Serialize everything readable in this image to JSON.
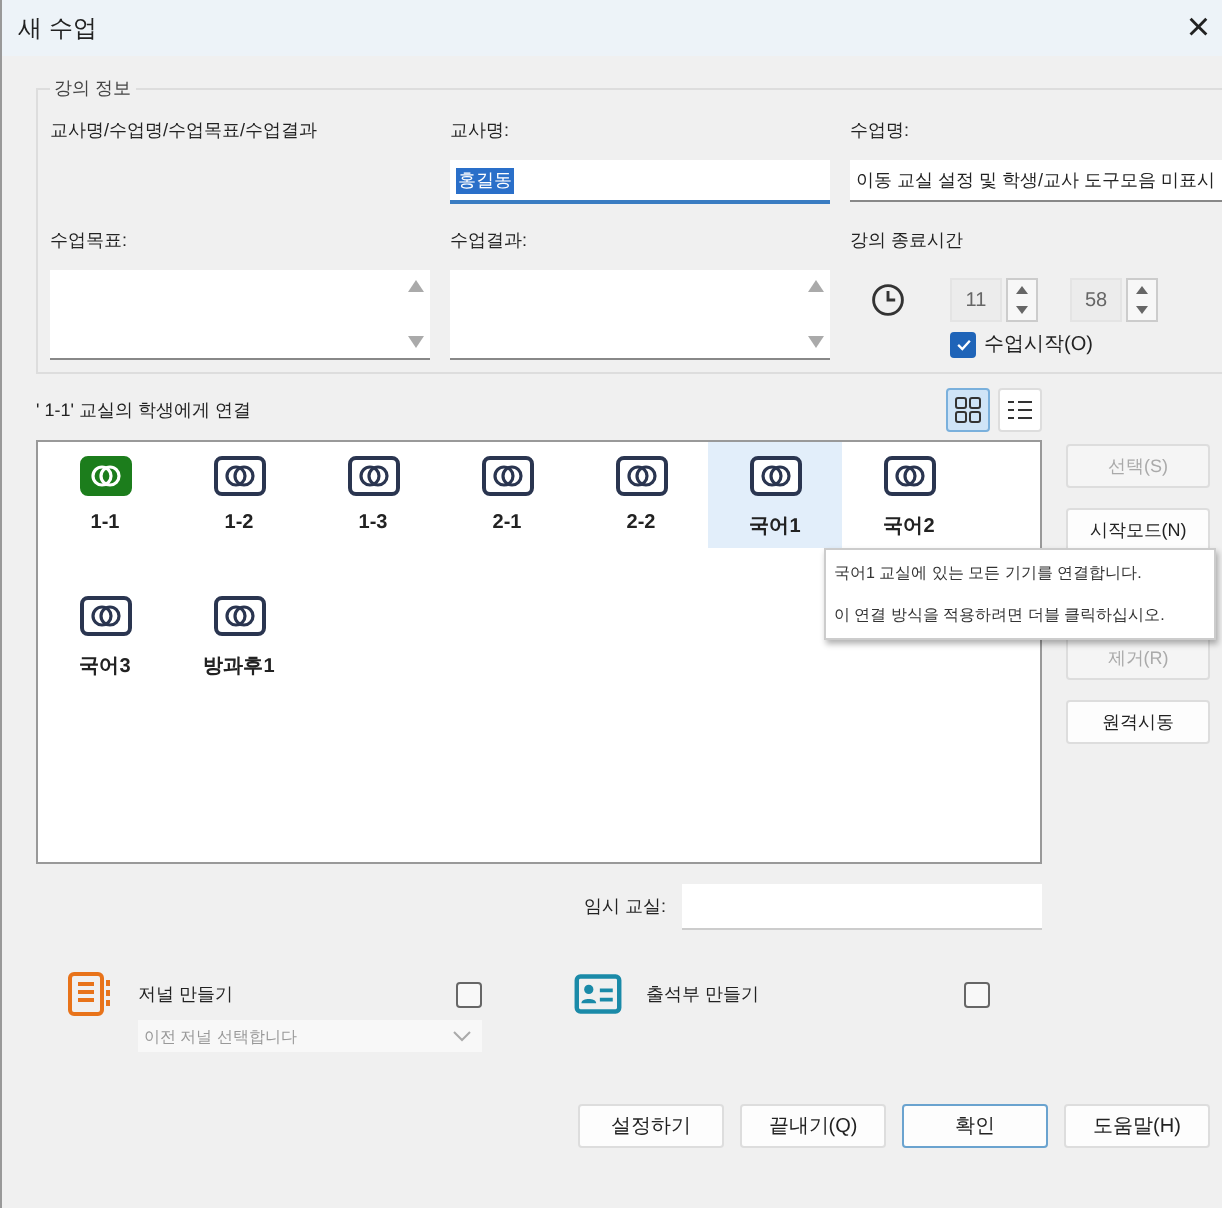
{
  "window": {
    "title": "새 수업",
    "close": "×"
  },
  "lecture_info": {
    "legend": "강의 정보",
    "summary": "교사명/수업명/수업목표/수업결과",
    "teacher": {
      "label": "교사명:",
      "value": "홍길동",
      "selected": true
    },
    "class_name": {
      "label": "수업명:",
      "value": "이동 교실 설정 및 학생/교사 도구모음 미표시"
    },
    "goal": {
      "label": "수업목표:"
    },
    "result": {
      "label": "수업결과:"
    },
    "end_time": {
      "label": "강의 종료시간",
      "hour": "11",
      "minute": "58"
    },
    "start_class": {
      "label": "수업시작(O)",
      "checked": true
    }
  },
  "connect": {
    "label": "' 1-1' 교실의 학생에게 연결",
    "views": [
      {
        "kind": "grid",
        "selected": true
      },
      {
        "kind": "list",
        "selected": false
      }
    ],
    "classrooms": [
      {
        "name": "1-1",
        "current": true,
        "selected": false
      },
      {
        "name": "1-2",
        "current": false,
        "selected": false
      },
      {
        "name": "1-3",
        "current": false,
        "selected": false
      },
      {
        "name": "2-1",
        "current": false,
        "selected": false
      },
      {
        "name": "2-2",
        "current": false,
        "selected": false
      },
      {
        "name": "국어1",
        "current": false,
        "selected": true
      },
      {
        "name": "국어2",
        "current": false,
        "selected": false
      },
      {
        "name": "국어3",
        "current": false,
        "selected": false
      },
      {
        "name": "방과후1",
        "current": false,
        "selected": false
      }
    ],
    "tooltip": [
      "국어1 교실에 있는 모든 기기를 연결합니다.",
      "이 연결 방식을 적용하려면 더블 클릭하십시오."
    ]
  },
  "side_buttons": [
    {
      "label": "선택(S)",
      "disabled": true
    },
    {
      "label": "시작모드(N)",
      "disabled": false
    },
    {
      "label": "제거(R)",
      "disabled": true
    },
    {
      "label": "원격시동",
      "disabled": false
    }
  ],
  "temp_classroom": {
    "label": "임시 교실:"
  },
  "journal": {
    "label": "저널 만들기",
    "checked": false,
    "select_placeholder": "이전 저널 선택합니다"
  },
  "attendance": {
    "label": "출석부 만들기",
    "checked": false
  },
  "buttons": [
    {
      "label": "설정하기",
      "default": false
    },
    {
      "label": "끝내기(Q)",
      "default": false
    },
    {
      "label": "확인",
      "default": true
    },
    {
      "label": "도움말(H)",
      "default": false
    }
  ]
}
